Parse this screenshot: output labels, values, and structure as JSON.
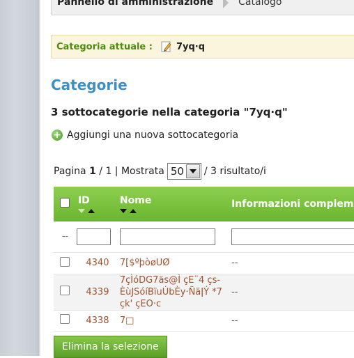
{
  "breadcrumb": {
    "root": "Pannello di amministrazione",
    "current": "Catalogo"
  },
  "current_category": {
    "label": "Categoria attuale :",
    "value": "7yq·q",
    "icon": "pencil-icon"
  },
  "section_title": "Categorie",
  "subcategory_count": "3 sottocategorie nella categoria \"7yq·q\"",
  "add_link": "Aggiungi una nuova sottocategoria",
  "pagination": {
    "prefix": "Pagina",
    "page": "1",
    "sep": "/ 1 | Mostrata",
    "per_page": "50",
    "suffix": "/ 3 risultato/i"
  },
  "table": {
    "headers": {
      "id": "ID",
      "name": "Nome",
      "info": "Informazioni compleme"
    },
    "filter_placeholder": "--",
    "rows": [
      {
        "id": "4340",
        "name": "7[$ºþòøUØ",
        "info": "--"
      },
      {
        "id": "4339",
        "name": "7çÌóDG7äs@Ì çE¨4 çs-ÈùJSóíBïuÚbÈy·ÑäǀÝ *7 çk' çEO·c",
        "info": "--"
      },
      {
        "id": "4338",
        "name": "7□",
        "info": "--"
      }
    ]
  },
  "delete_button": "Elimina la selezione",
  "colors": {
    "accent_green": "#6bb530",
    "title_blue": "#3d8fc4",
    "link_brown": "#a0522d"
  }
}
